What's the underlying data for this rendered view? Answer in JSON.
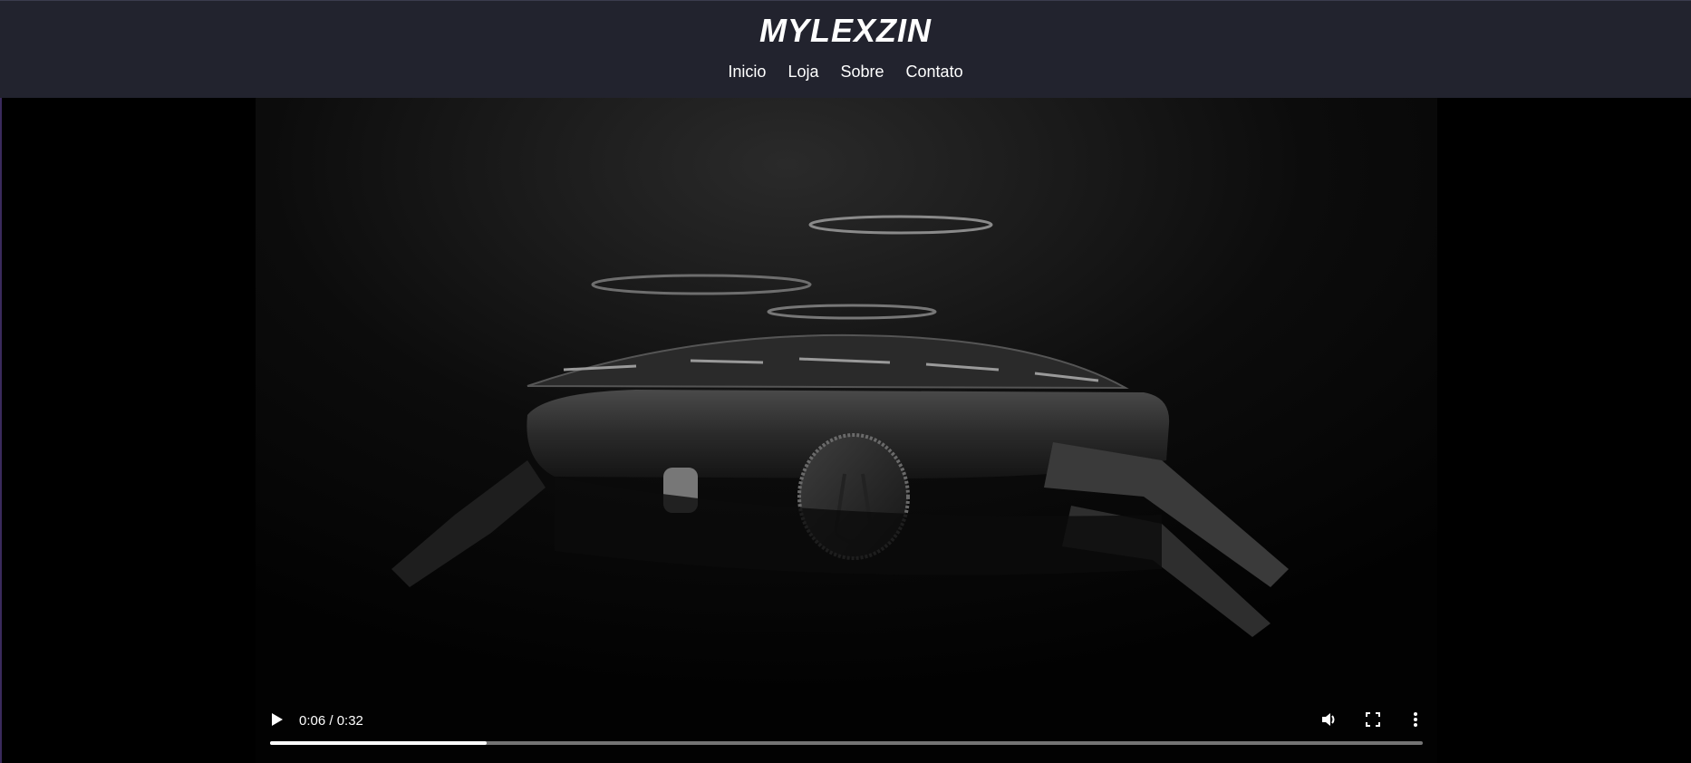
{
  "site": {
    "logo": "MYLEXZIN",
    "nav": [
      "Inicio",
      "Loja",
      "Sobre",
      "Contato"
    ]
  },
  "video": {
    "time_display": "0:06 / 0:32",
    "current_seconds": 6,
    "duration_seconds": 32,
    "progress_fraction": 0.1875,
    "controls": {
      "play": "play-icon",
      "volume": "volume-icon",
      "fullscreen": "fullscreen-icon",
      "more": "more-vertical-icon"
    }
  },
  "colors": {
    "header_bg": "#22232e",
    "page_bg": "#000000",
    "text": "#ffffff"
  }
}
